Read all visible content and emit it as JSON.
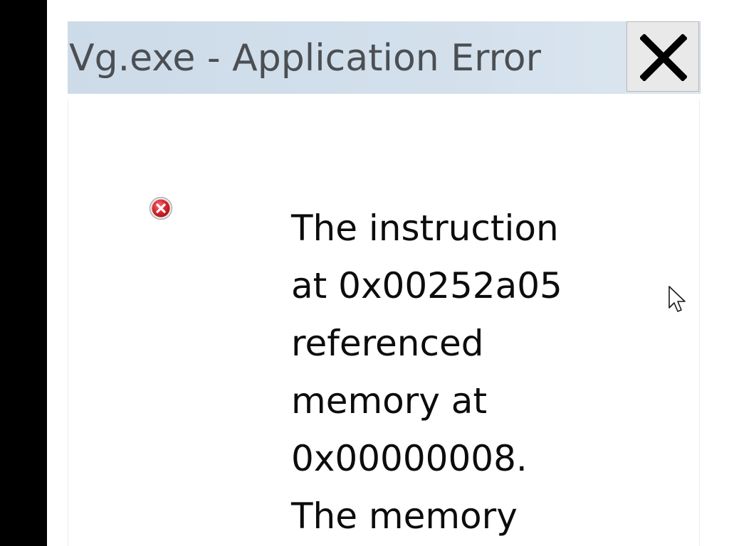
{
  "dialog": {
    "title": "Vg.exe - Application Error",
    "close_icon": "close-icon",
    "error_icon": "error-icon",
    "message_lines": [
      "The instruction",
      "at 0x00252a05",
      "referenced",
      "memory at",
      "0x00000008.",
      "The memory"
    ]
  },
  "colors": {
    "titlebar": "#d3e0ec",
    "title_text": "#4b4f53",
    "error_icon": "#d9262f",
    "background": "#000000"
  }
}
